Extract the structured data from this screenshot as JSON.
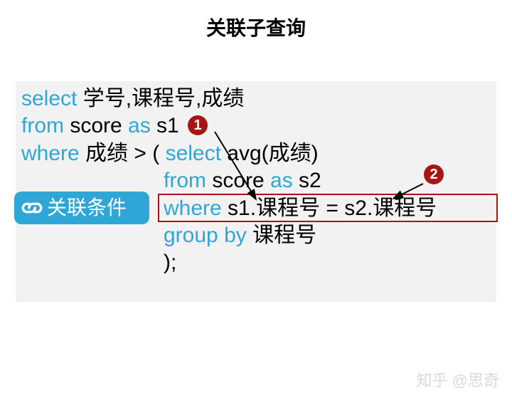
{
  "title": "关联子查询",
  "code": {
    "l1": {
      "kw1": "select",
      "t1": " 学号,课程号,成绩"
    },
    "l2": {
      "kw1": "from",
      "t1": " score ",
      "kw2": "as",
      "t2": " s1 "
    },
    "l3": {
      "kw1": "where",
      "t1": " 成绩 > ( ",
      "kw2": "select",
      "t2": " avg(成绩)"
    },
    "l4": {
      "kw1": "from",
      "t1": " score ",
      "kw2": "as",
      "t2": " s2"
    },
    "l5": {
      "kw1": "where",
      "t1": " s1.课程号 = s2.课程号"
    },
    "l6": {
      "kw1": "group by",
      "t1": " 课程号"
    },
    "l7": {
      "t1": ");"
    }
  },
  "badges": {
    "one": "1",
    "two": "2"
  },
  "tag": {
    "label": "关联条件"
  },
  "watermark": "知乎 @思奇"
}
